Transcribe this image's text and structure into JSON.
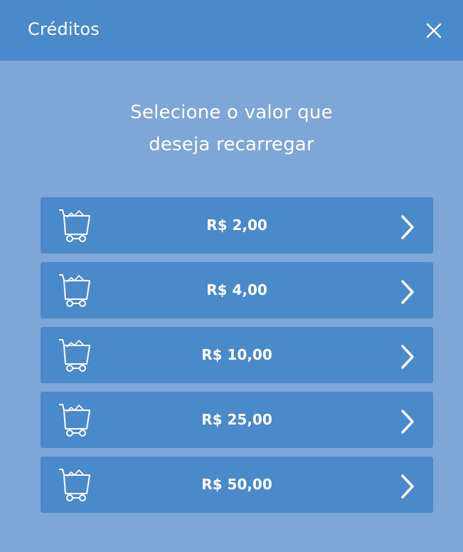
{
  "dialog": {
    "title": "Créditos",
    "close_icon": "close-icon",
    "prompt_line1": "Selecione o valor que",
    "prompt_line2": "deseja recarregar"
  },
  "options": [
    {
      "label": "R$ 2,00",
      "icon": "shopping-cart-icon"
    },
    {
      "label": "R$ 4,00",
      "icon": "shopping-cart-icon"
    },
    {
      "label": "R$ 10,00",
      "icon": "shopping-cart-icon"
    },
    {
      "label": "R$ 25,00",
      "icon": "shopping-cart-icon"
    },
    {
      "label": "R$ 50,00",
      "icon": "shopping-cart-icon"
    }
  ],
  "colors": {
    "background": "#7ea6d6",
    "accent": "#4a89ca",
    "text": "#ffffff"
  }
}
